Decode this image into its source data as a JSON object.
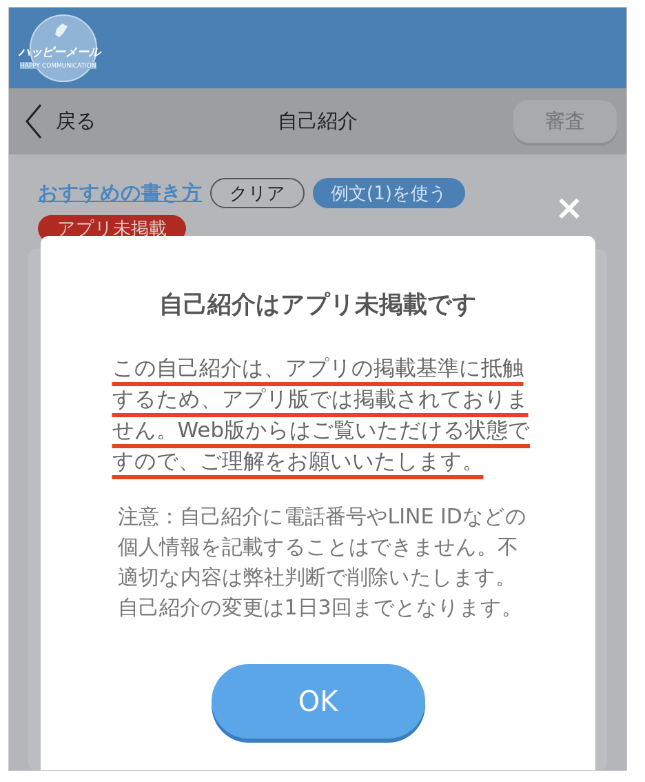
{
  "logo": {
    "name": "ハッピーメール",
    "tagline": "HAPPY COMMUNICATION"
  },
  "nav": {
    "back": "戻る",
    "title": "自己紹介",
    "action": "審査",
    "action_disabled": true
  },
  "toolbar": {
    "link": "おすすめの書き方",
    "buttons": [
      {
        "label": "クリア",
        "kind": "outline"
      },
      {
        "label": "例文(1)を使う",
        "kind": "filled"
      }
    ],
    "badge": "アプリ未掲載"
  },
  "dialog": {
    "title": "自己紹介はアプリ未掲載です",
    "message": "この自己紹介は、アプリの掲載基準に抵触するため、アプリ版では掲載されておりません。Web版からはご覧いただける状態ですので、ご理解をお願いいたします。",
    "message_underlined": true,
    "note": "注意：自己紹介に電話番号やLINE IDなどの個人情報を記載することはできません。不適切な内容は弊社判断で削除いたします。自己紹介の変更は1日3回までとなります。",
    "ok": "OK",
    "close": "×"
  }
}
